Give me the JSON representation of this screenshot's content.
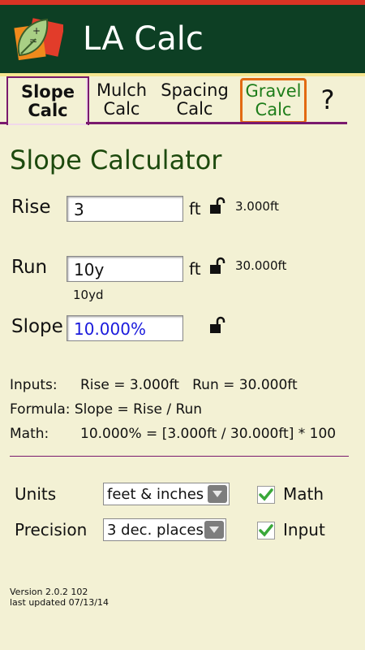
{
  "app": {
    "title": "LA Calc",
    "icon": "calculator-leaf-icon"
  },
  "tabs": [
    {
      "label_line1": "Slope",
      "label_line2": "Calc",
      "active": true
    },
    {
      "label_line1": "Mulch",
      "label_line2": "Calc"
    },
    {
      "label_line1": "Spacing",
      "label_line2": "Calc"
    },
    {
      "label_line1": "Gravel",
      "label_line2": "Calc"
    },
    {
      "label": "?"
    }
  ],
  "page_title": "Slope Calculator",
  "rise": {
    "label": "Rise",
    "value": "3",
    "unit": "ft",
    "computed": "3.000ft"
  },
  "run": {
    "label": "Run",
    "value": "10y",
    "unit": "ft",
    "computed": "30.000ft",
    "hint": "10yd"
  },
  "slope": {
    "label": "Slope",
    "value": "10.000%"
  },
  "info": {
    "inputs_label": "Inputs:",
    "inputs_text": "Rise = 3.000ft   Run = 30.000ft",
    "formula_label": "Formula:",
    "formula_text": "Slope = Rise / Run",
    "math_label": "Math:",
    "math_text": "10.000% = [3.000ft / 30.000ft] * 100"
  },
  "settings": {
    "units_label": "Units",
    "units_value": "feet & inches",
    "precision_label": "Precision",
    "precision_value": "3 dec. places",
    "math_check_label": "Math",
    "input_check_label": "Input"
  },
  "version": {
    "line1": "Version 2.0.2 102",
    "line2": "last updated 07/13/14"
  },
  "colors": {
    "appbar": "#0d3f24",
    "accent": "#7a1a6e",
    "gravel": "#1e7d1a",
    "check": "#3aa83a"
  }
}
